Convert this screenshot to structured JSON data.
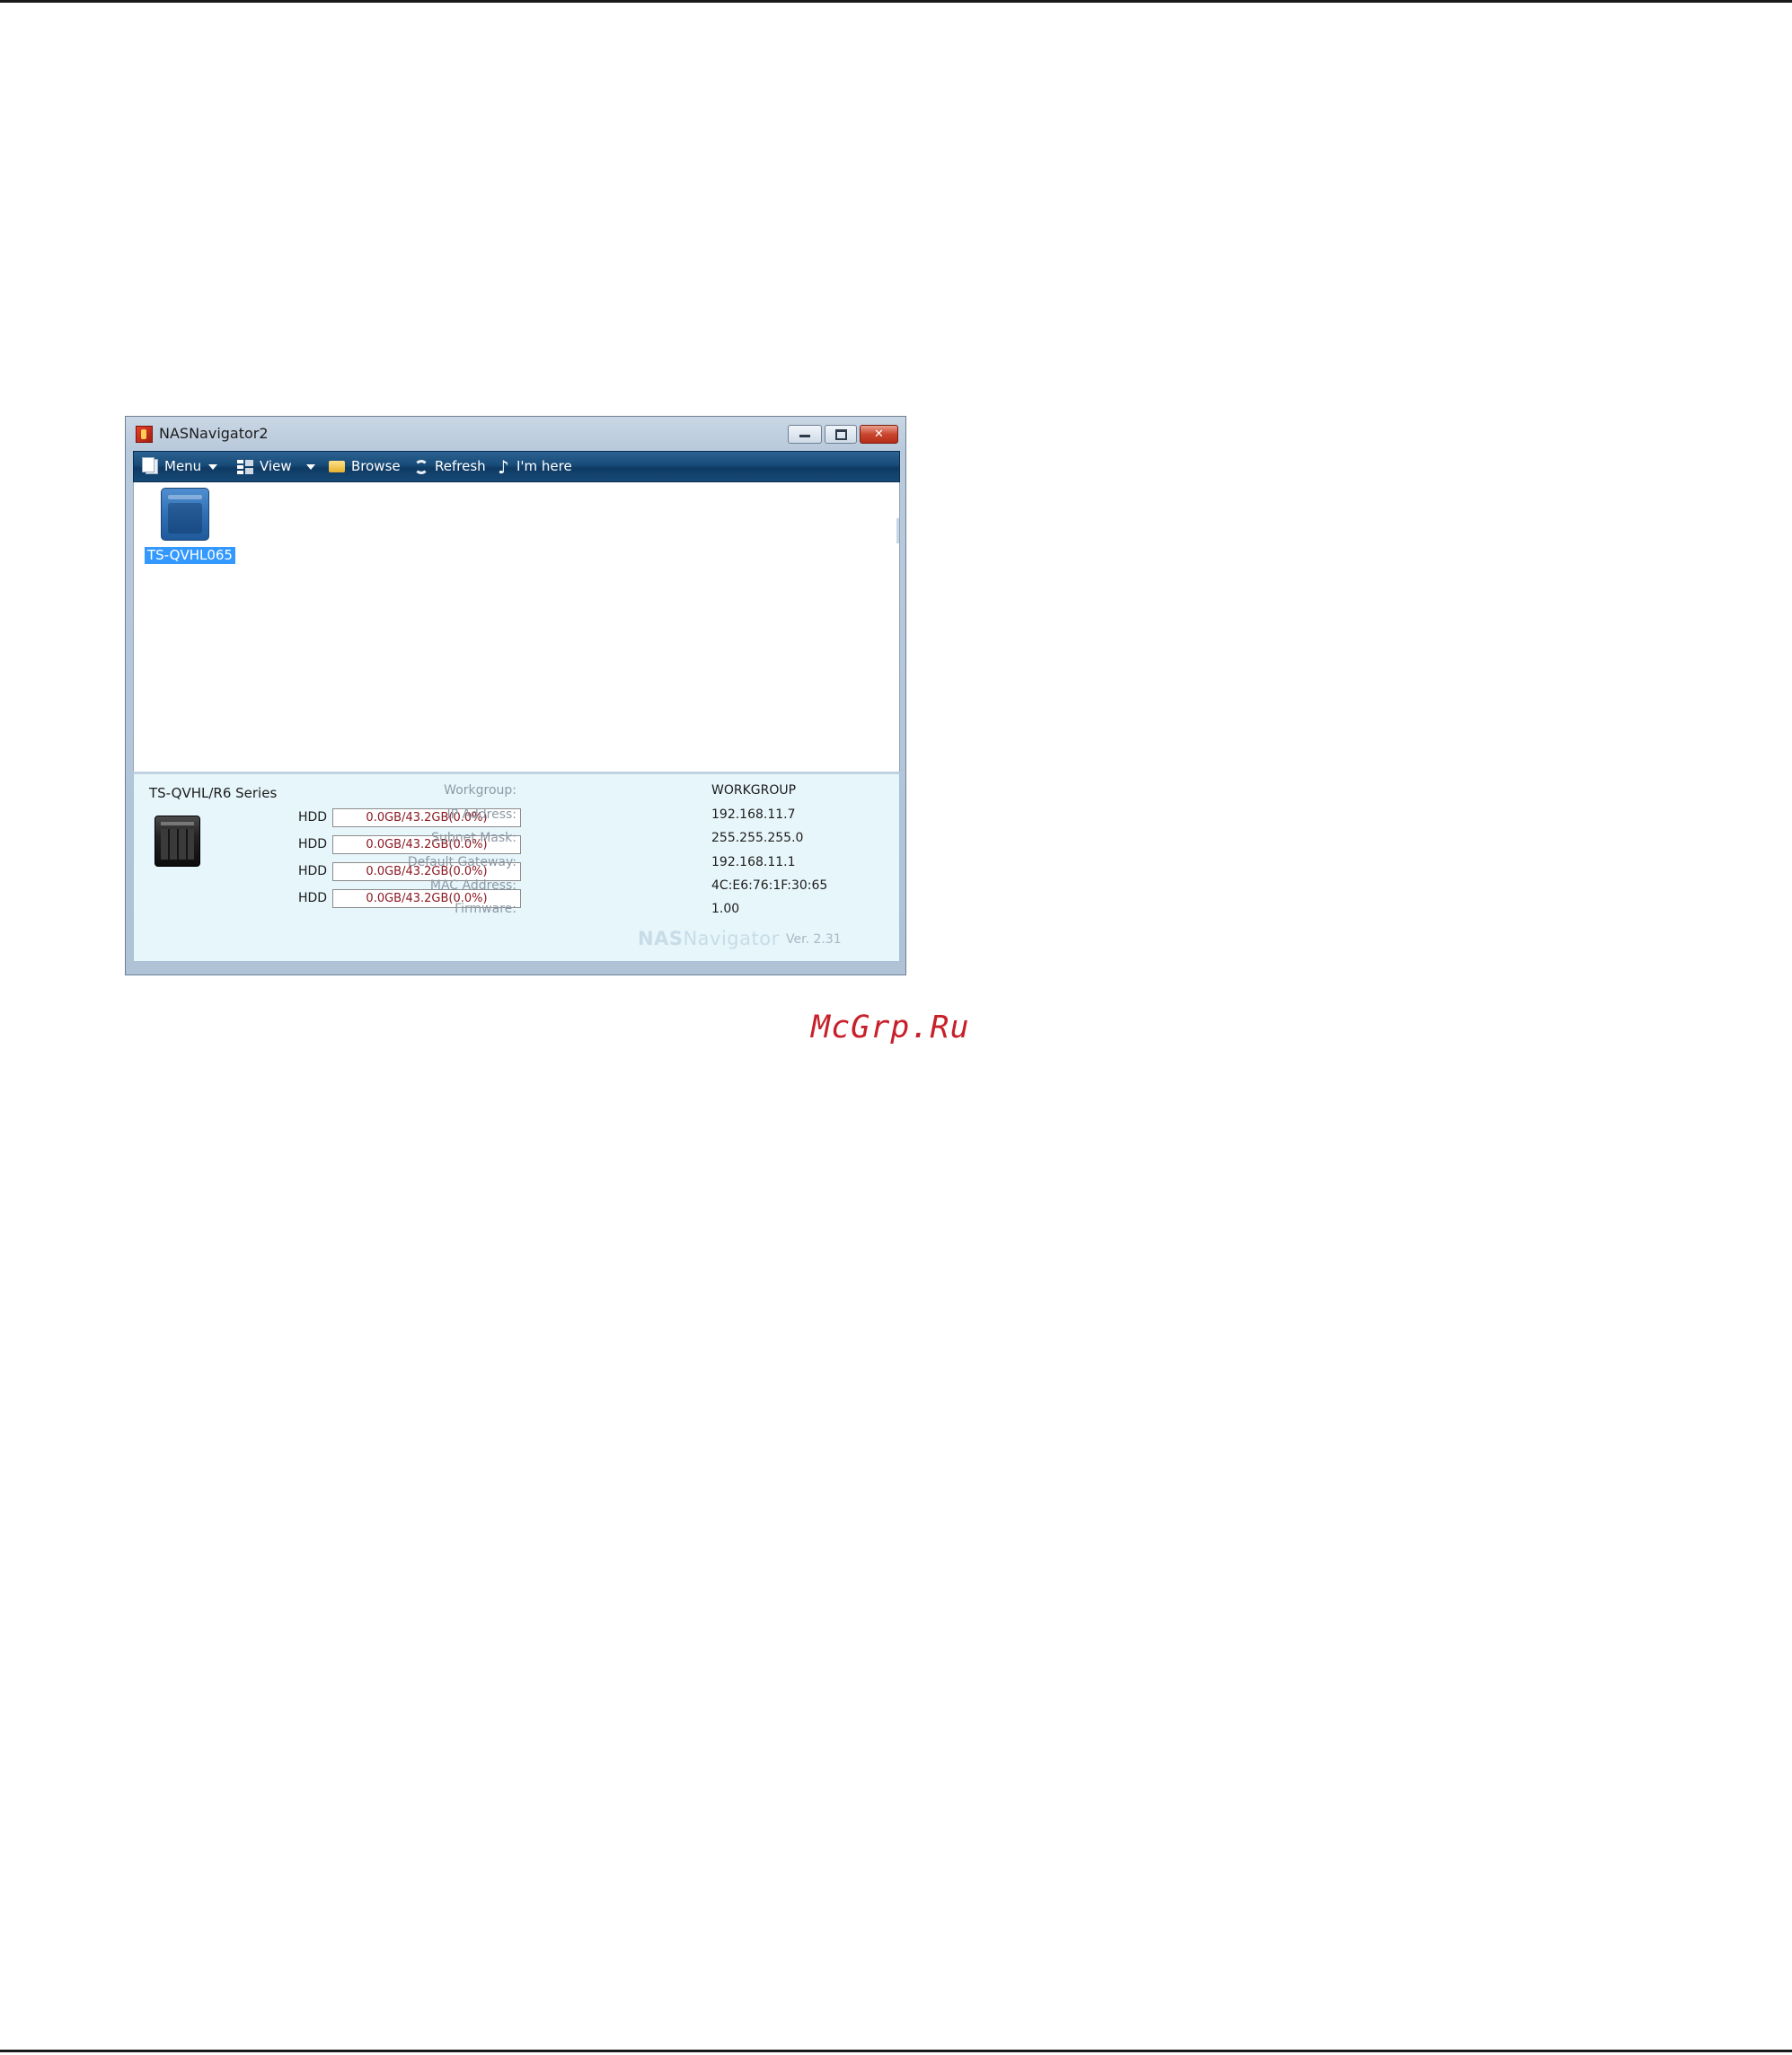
{
  "window": {
    "title": "NASNavigator2",
    "controls": {
      "close_glyph": "✕"
    }
  },
  "toolbar": {
    "menu_label": "Menu",
    "view_label": "View",
    "browse_label": "Browse",
    "refresh_label": "Refresh",
    "imhere_label": "I'm here",
    "note_glyph": "♪"
  },
  "devices": [
    {
      "name": "TS-QVHL065",
      "selected": true
    }
  ],
  "info": {
    "model": "TS-QVHL/R6 Series",
    "hdd_label": "HDD",
    "hdds": [
      {
        "label": "HDD",
        "usage": "0.0GB/43.2GB(0.0%)"
      },
      {
        "label": "HDD",
        "usage": "0.0GB/43.2GB(0.0%)"
      },
      {
        "label": "HDD",
        "usage": "0.0GB/43.2GB(0.0%)"
      },
      {
        "label": "HDD",
        "usage": "0.0GB/43.2GB(0.0%)"
      }
    ],
    "details": [
      {
        "key": "Workgroup:",
        "value": "WORKGROUP"
      },
      {
        "key": "IP Address:",
        "value": "192.168.11.7"
      },
      {
        "key": "Subnet Mask:",
        "value": "255.255.255.0"
      },
      {
        "key": "Default Gateway:",
        "value": "192.168.11.1"
      },
      {
        "key": "MAC Address:",
        "value": "4C:E6:76:1F:30:65"
      },
      {
        "key": "Firmware:",
        "value": "1.00"
      }
    ],
    "logo_bold": "NAS",
    "logo_thin": "Navigator",
    "version": "Ver. 2.31"
  },
  "watermark": "McGrp.Ru",
  "colors": {
    "toolbar": "#184b78",
    "selection": "#3399ff",
    "hdd_text": "#8a1822",
    "watermark": "#c8202a"
  }
}
